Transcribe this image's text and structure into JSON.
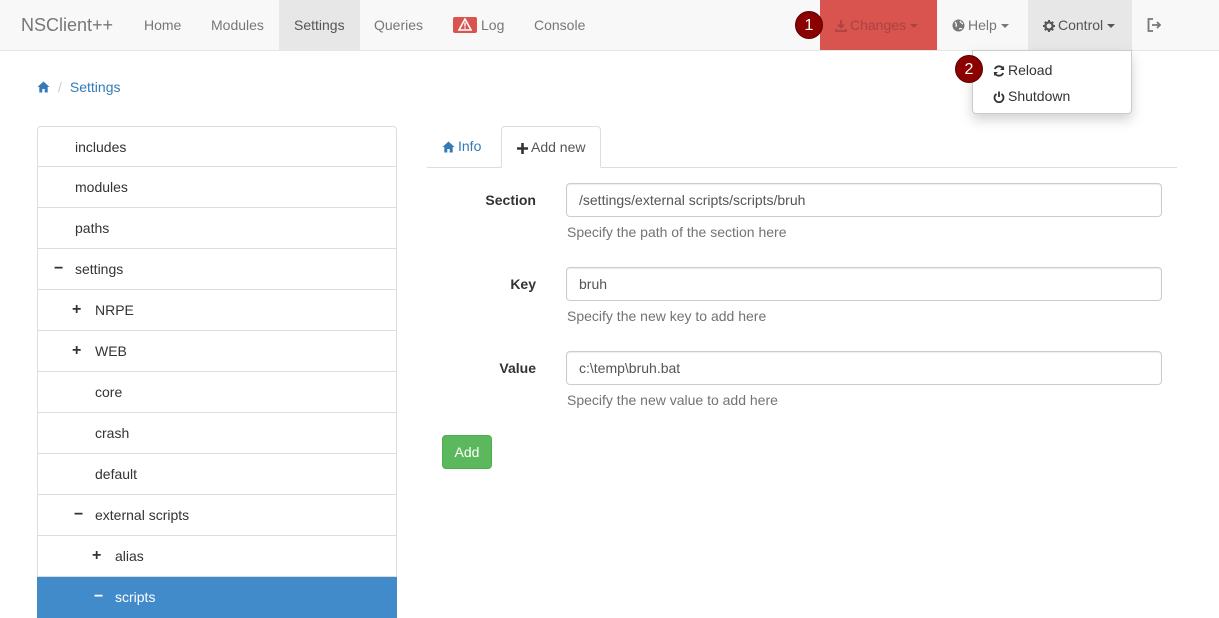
{
  "navbar": {
    "brand": "NSClient++",
    "items": [
      {
        "label": "Home"
      },
      {
        "label": "Modules"
      },
      {
        "label": "Settings"
      },
      {
        "label": "Queries"
      },
      {
        "label": "Log"
      },
      {
        "label": "Console"
      }
    ],
    "changes_label": "Changes",
    "help_label": "Help",
    "control_label": "Control"
  },
  "markers": [
    "1",
    "2"
  ],
  "control_menu": {
    "items": [
      {
        "label": "Reload",
        "icon": "refresh-icon"
      },
      {
        "label": "Shutdown",
        "icon": "power-icon"
      }
    ]
  },
  "breadcrumb": {
    "home_icon": "home-icon",
    "current": "Settings"
  },
  "tree": [
    {
      "label": "includes"
    },
    {
      "label": "modules"
    },
    {
      "label": "paths"
    },
    {
      "label": "settings",
      "toggle": "−"
    },
    {
      "label": "NRPE",
      "toggle": "+"
    },
    {
      "label": "WEB",
      "toggle": "+"
    },
    {
      "label": "core"
    },
    {
      "label": "crash"
    },
    {
      "label": "default"
    },
    {
      "label": "external scripts",
      "toggle": "−"
    },
    {
      "label": "alias",
      "toggle": "+"
    },
    {
      "label": "scripts",
      "toggle": "−",
      "selected": true
    }
  ],
  "tabs": {
    "info": "Info",
    "add_new": "Add new"
  },
  "form": {
    "section_label": "Section",
    "section_value": "/settings/external scripts/scripts/bruh",
    "section_help": "Specify the path of the section here",
    "key_label": "Key",
    "key_value": "bruh",
    "key_help": "Specify the new key to add here",
    "value_label": "Value",
    "value_value": "c:\\temp\\bruh.bat",
    "value_help": "Specify the new value to add here",
    "add_button": "Add"
  },
  "colors": {
    "changes_bg": "#d9534f",
    "selected_row": "#428bca",
    "add_button": "#5cb85c",
    "marker": "#8b0000",
    "link": "#337ab7"
  }
}
